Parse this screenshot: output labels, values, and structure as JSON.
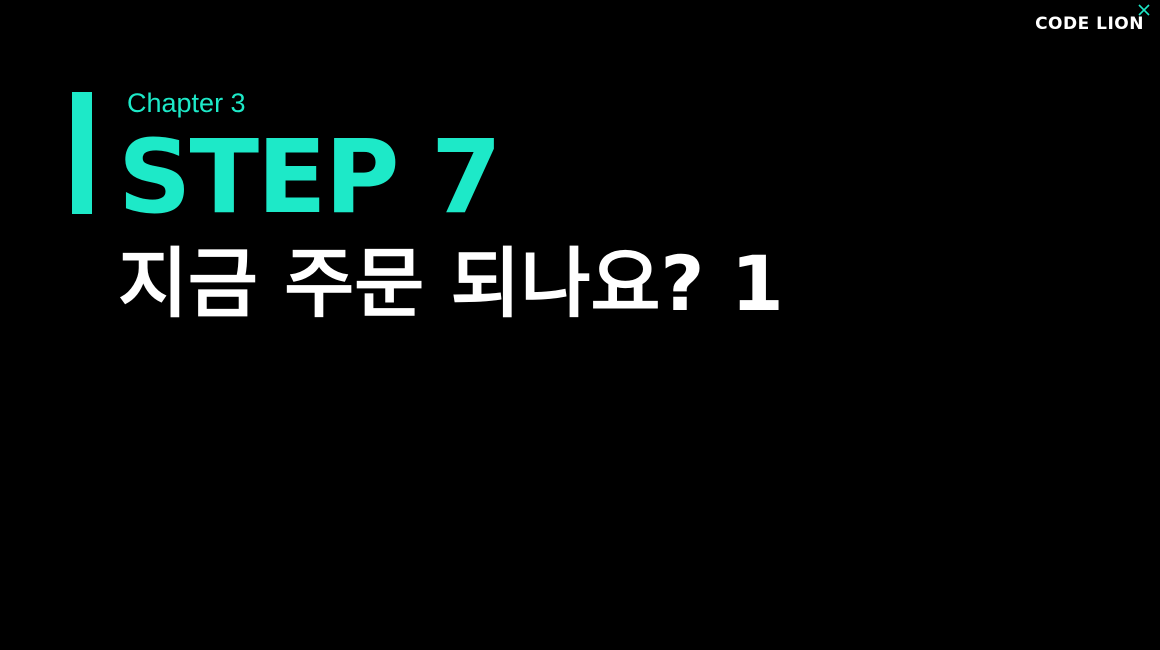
{
  "slide": {
    "chapter": "Chapter 3",
    "step": "STEP 7",
    "subtitle": "지금 주문 되나요? 1"
  },
  "logo": {
    "text": "CODE LION"
  },
  "colors": {
    "accent": "#1de9c8",
    "background": "#000000",
    "text": "#ffffff"
  }
}
